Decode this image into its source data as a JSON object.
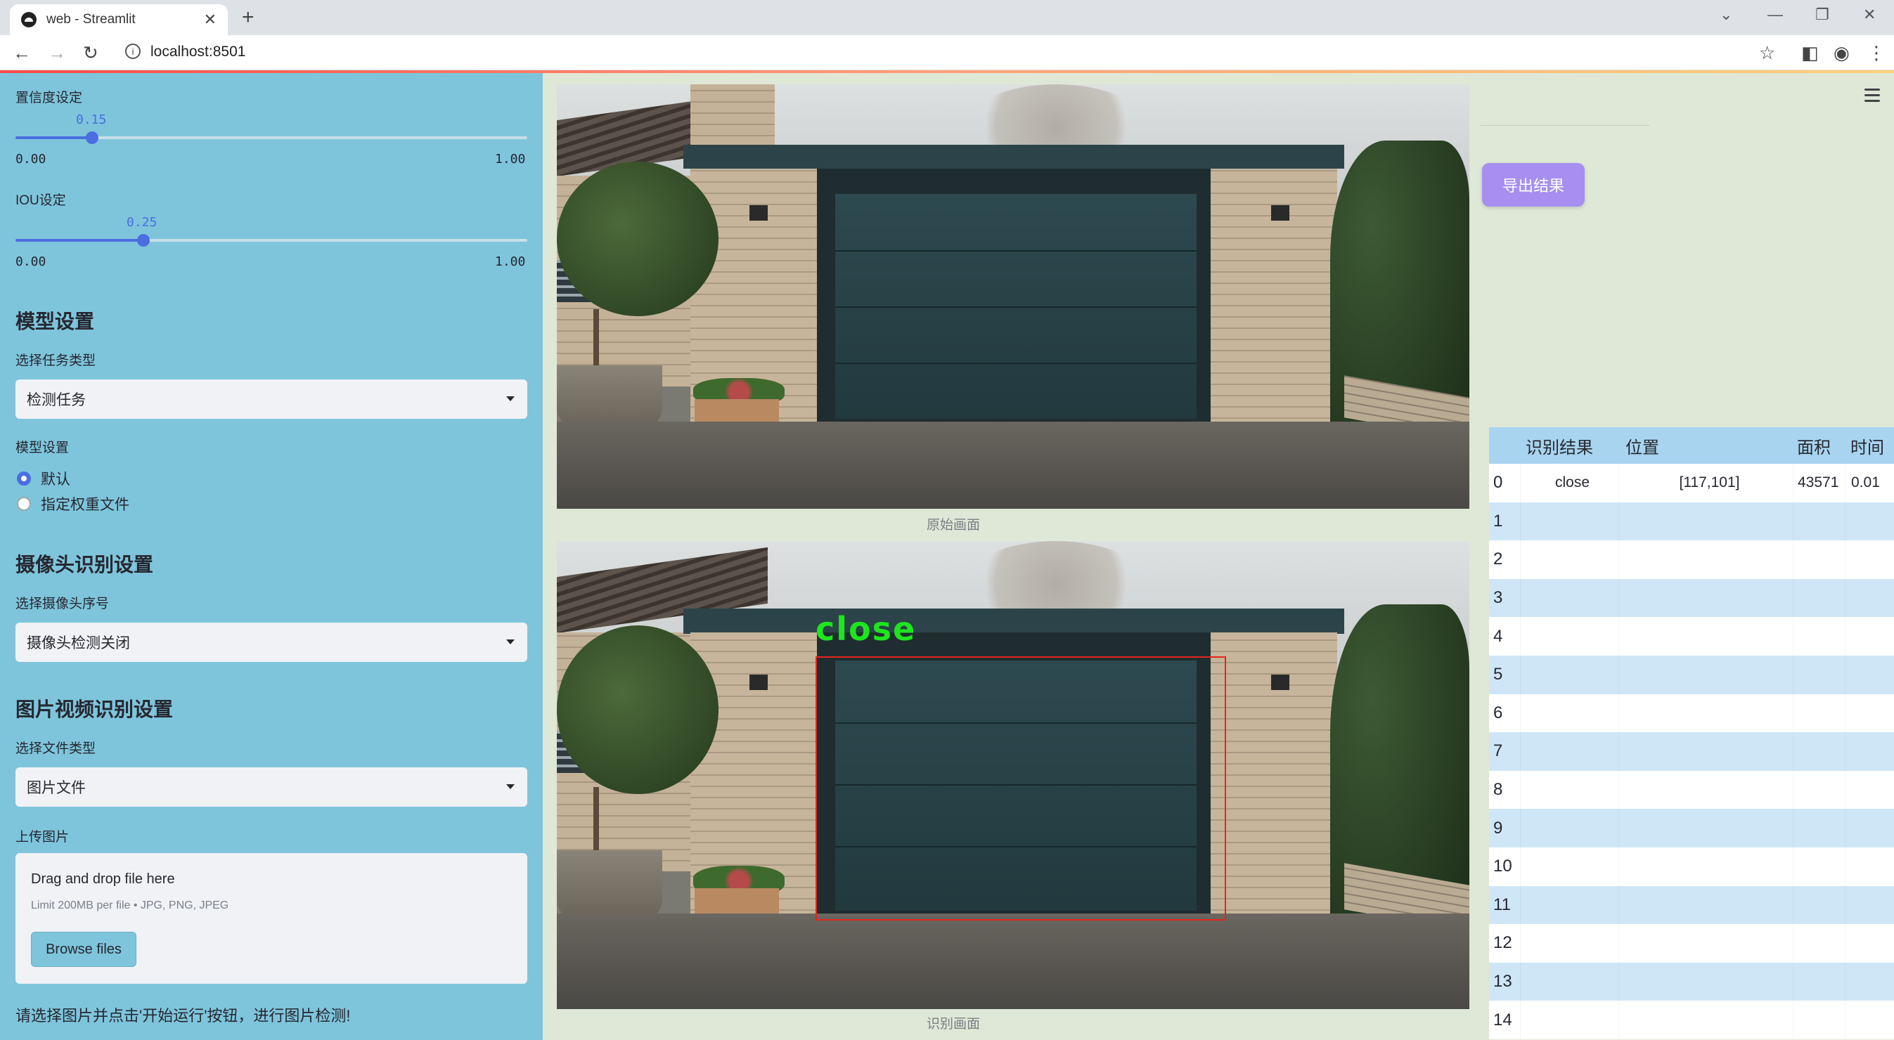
{
  "browser": {
    "tab_title": "web - Streamlit",
    "url": "localhost:8501",
    "info_icon": "info-icon"
  },
  "sidebar": {
    "confidence": {
      "label": "置信度设定",
      "value": "0.15",
      "value_num": 0.15,
      "min": "0.00",
      "max": "1.00"
    },
    "iou": {
      "label": "IOU设定",
      "value": "0.25",
      "value_num": 0.25,
      "min": "0.00",
      "max": "1.00"
    },
    "model_heading": "模型设置",
    "task_type_label": "选择任务类型",
    "task_type_value": "检测任务",
    "model_settings_label": "模型设置",
    "radio_default": "默认",
    "radio_custom": "指定权重文件",
    "camera_heading": "摄像头识别设置",
    "camera_label": "选择摄像头序号",
    "camera_value": "摄像头检测关闭",
    "media_heading": "图片视频识别设置",
    "file_type_label": "选择文件类型",
    "file_type_value": "图片文件",
    "upload_label": "上传图片",
    "upload_title": "Drag and drop file here",
    "upload_limit": "Limit 200MB per file • JPG, PNG, JPEG",
    "browse_label": "Browse files",
    "hint": "请选择图片并点击'开始运行'按钮，进行图片检测!"
  },
  "main": {
    "original_caption": "原始画面",
    "result_caption": "识别画面",
    "detection_label": "close",
    "export_label": "导出结果"
  },
  "table": {
    "headers": [
      "",
      "识别结果",
      "位置",
      "面积",
      "时间"
    ],
    "rows": [
      [
        "0",
        "close",
        "[117,101]",
        "43571",
        "0.01"
      ],
      [
        "1",
        "",
        "",
        "",
        ""
      ],
      [
        "2",
        "",
        "",
        "",
        ""
      ],
      [
        "3",
        "",
        "",
        "",
        ""
      ],
      [
        "4",
        "",
        "",
        "",
        ""
      ],
      [
        "5",
        "",
        "",
        "",
        ""
      ],
      [
        "6",
        "",
        "",
        "",
        ""
      ],
      [
        "7",
        "",
        "",
        "",
        ""
      ],
      [
        "8",
        "",
        "",
        "",
        ""
      ],
      [
        "9",
        "",
        "",
        "",
        ""
      ],
      [
        "10",
        "",
        "",
        "",
        ""
      ],
      [
        "11",
        "",
        "",
        "",
        ""
      ],
      [
        "12",
        "",
        "",
        "",
        ""
      ],
      [
        "13",
        "",
        "",
        "",
        ""
      ],
      [
        "14",
        "",
        "",
        "",
        ""
      ]
    ]
  },
  "colors": {
    "sidebar_bg": "#7ec5dc",
    "main_bg": "#dfe8d6",
    "accent": "#4a6ee0",
    "export_button": "#a68ff0",
    "detection_box": "#e8241c",
    "detection_text": "#1ee51e"
  }
}
